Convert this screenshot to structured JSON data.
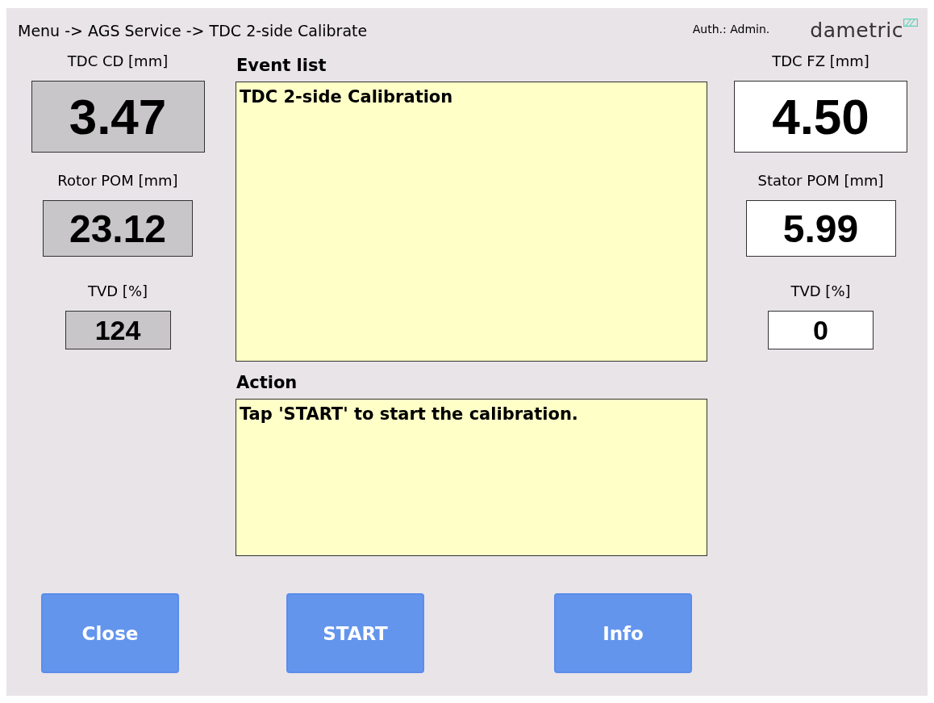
{
  "header": {
    "breadcrumb": "Menu -> AGS Service -> TDC 2-side Calibrate",
    "auth": "Auth.: Admin.",
    "logo": "dametric"
  },
  "left_readouts": [
    {
      "label": "TDC CD [mm]",
      "value": "3.47",
      "shaded": true
    },
    {
      "label": "Rotor POM [mm]",
      "value": "23.12",
      "shaded": true
    },
    {
      "label": "TVD [%]",
      "value": "124",
      "shaded": true
    }
  ],
  "event_list": {
    "label": "Event list",
    "text": "TDC 2-side Calibration"
  },
  "action": {
    "label": "Action",
    "text": "Tap 'START' to start the calibration."
  },
  "right_readouts": [
    {
      "label": "TDC FZ [mm]",
      "value": "4.50",
      "shaded": false
    },
    {
      "label": "Stator POM [mm]",
      "value": "5.99",
      "shaded": false
    },
    {
      "label": "TVD [%]",
      "value": "0",
      "shaded": false
    }
  ],
  "buttons": [
    "Close",
    "START",
    "Info"
  ]
}
